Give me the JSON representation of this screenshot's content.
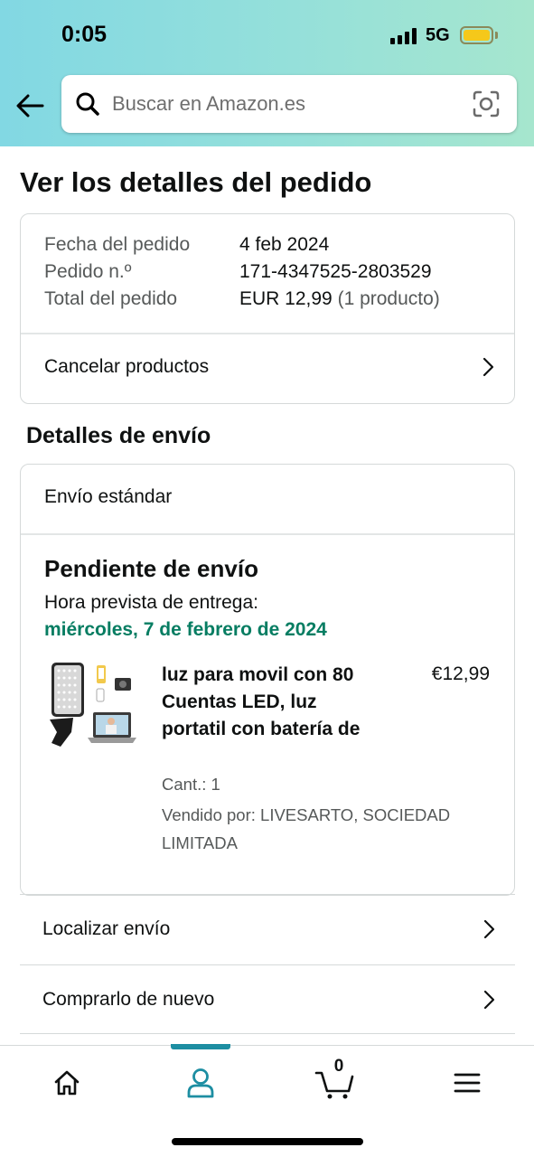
{
  "status_bar": {
    "time": "0:05",
    "network": "5G"
  },
  "search": {
    "placeholder": "Buscar en Amazon.es"
  },
  "page_title": "Ver los detalles del pedido",
  "order": {
    "rows": [
      {
        "label": "Fecha del pedido",
        "value": "4 feb 2024",
        "extra": ""
      },
      {
        "label": "Pedido n.º",
        "value": "171-4347525-2803529",
        "extra": ""
      },
      {
        "label": "Total del pedido",
        "value": "EUR 12,99",
        "extra": "(1 producto)"
      }
    ],
    "cancel_label": "Cancelar productos"
  },
  "shipping": {
    "section_title": "Detalles de envío",
    "method": "Envío estándar",
    "status": "Pendiente de envío",
    "eta_label": "Hora prevista de entrega:",
    "eta_date": "miércoles, 7 de febrero de 2024",
    "product": {
      "title": "luz para movil con 80 Cuentas LED, luz portatil con batería de",
      "price": "€12,99",
      "quantity": "Cant.: 1",
      "seller": "Vendido por: LIVESARTO, SOCIEDAD LIMITADA"
    }
  },
  "actions": {
    "track": "Localizar envío",
    "buy_again": "Comprarlo de nuevo"
  },
  "tabbar": {
    "cart_count": "0",
    "active_tab": "account",
    "accent_color": "#1d8ea2"
  },
  "colors": {
    "eta_green": "#067d62",
    "header_gradient_start": "#82d8e3",
    "header_gradient_end": "#a6e6ce"
  },
  "icons": [
    "back-arrow-icon",
    "search-icon",
    "camera-lens-icon",
    "chevron-right-icon",
    "home-icon",
    "account-icon",
    "cart-icon",
    "menu-icon"
  ]
}
